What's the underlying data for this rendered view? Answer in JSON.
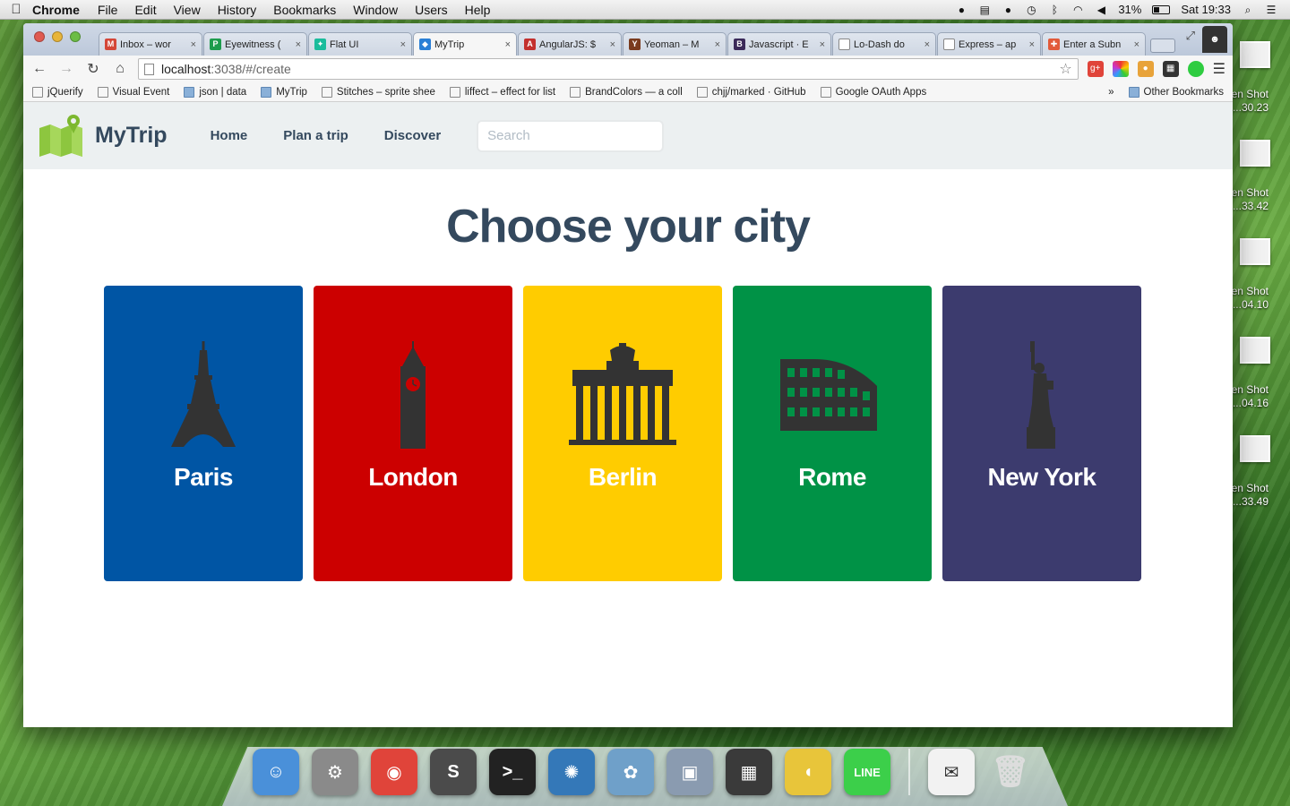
{
  "menubar": {
    "app_name": "Chrome",
    "items": [
      "File",
      "Edit",
      "View",
      "History",
      "Bookmarks",
      "Window",
      "Users",
      "Help"
    ],
    "battery": "31%",
    "clock": "Sat 19:33"
  },
  "desktop": {
    "screenshots": [
      {
        "label_line1": "en Shot",
        "label_line2": "...30.23"
      },
      {
        "label_line1": "en Shot",
        "label_line2": "...33.42"
      },
      {
        "label_line1": "en Shot",
        "label_line2": "...04.10"
      },
      {
        "label_line1": "en Shot",
        "label_line2": "...04.16"
      },
      {
        "label_line1": "en Shot",
        "label_line2": "...33.49"
      }
    ]
  },
  "tabs": [
    {
      "label": "Inbox – wor",
      "fav_text": "M",
      "fav_color": "#d44638"
    },
    {
      "label": "Eyewitness (",
      "fav_text": "P",
      "fav_color": "#1e9c4d"
    },
    {
      "label": "Flat UI",
      "fav_text": "✦",
      "fav_color": "#1abc9c"
    },
    {
      "label": "MyTrip",
      "fav_text": "◆",
      "fav_color": "#2a7fd6"
    },
    {
      "label": "AngularJS: $",
      "fav_text": "A",
      "fav_color": "#c3302e"
    },
    {
      "label": "Yeoman – M",
      "fav_text": "Y",
      "fav_color": "#7a3b1e"
    },
    {
      "label": "Javascript · E",
      "fav_text": "B",
      "fav_color": "#3b2a5a"
    },
    {
      "label": "Lo-Dash do",
      "fav_text": "",
      "fav_color": "#ffffff"
    },
    {
      "label": "Express – ap",
      "fav_text": "",
      "fav_color": "#ffffff"
    },
    {
      "label": "Enter a Subn",
      "fav_text": "✚",
      "fav_color": "#e25a3a"
    }
  ],
  "toolbar": {
    "url_host": "localhost",
    "url_path": ":3038/#/create"
  },
  "bookmarks": [
    {
      "label": "jQuerify",
      "folder": false,
      "faded": false
    },
    {
      "label": "Visual Event",
      "folder": false,
      "faded": false
    },
    {
      "label": "json | data",
      "folder": true,
      "faded": false
    },
    {
      "label": "MyTrip",
      "folder": true,
      "faded": false
    },
    {
      "label": "Stitches – sprite shee",
      "folder": false,
      "faded": false
    },
    {
      "label": "liffect – effect for list",
      "folder": false,
      "faded": false
    },
    {
      "label": "BrandColors — a coll",
      "folder": false,
      "faded": false
    },
    {
      "label": "chjj/marked · GitHub",
      "folder": false,
      "faded": false
    },
    {
      "label": "Google OAuth Apps",
      "folder": false,
      "faded": false
    }
  ],
  "bookmarks_more": "»",
  "bookmarks_other": "Other Bookmarks",
  "app": {
    "brand": "MyTrip",
    "nav": [
      "Home",
      "Plan a trip",
      "Discover"
    ],
    "search_placeholder": "Search",
    "heading": "Choose your city",
    "cities": [
      {
        "name": "Paris",
        "color": "#0055a4",
        "icon": "eiffel-tower-icon"
      },
      {
        "name": "London",
        "color": "#cc0000",
        "icon": "big-ben-icon"
      },
      {
        "name": "Berlin",
        "color": "#ffcc00",
        "icon": "brandenburg-gate-icon"
      },
      {
        "name": "Rome",
        "color": "#009246",
        "icon": "colosseum-icon"
      },
      {
        "name": "New York",
        "color": "#3c3b6e",
        "icon": "statue-of-liberty-icon"
      }
    ]
  },
  "dock": {
    "apps": [
      {
        "name": "finder",
        "glyph": "☺",
        "color": "#4a90d9"
      },
      {
        "name": "system-preferences",
        "glyph": "⚙",
        "color": "#8a8a8a"
      },
      {
        "name": "chrome",
        "glyph": "◉",
        "color": "#e0443a"
      },
      {
        "name": "sublime-text",
        "glyph": "S",
        "color": "#4b4b4b"
      },
      {
        "name": "terminal",
        "glyph": ">_",
        "color": "#222222"
      },
      {
        "name": "sourcetree",
        "glyph": "✺",
        "color": "#3478b8"
      },
      {
        "name": "preview",
        "glyph": "✿",
        "color": "#6fa0c9"
      },
      {
        "name": "iphoto",
        "glyph": "▣",
        "color": "#8a9bb0"
      },
      {
        "name": "calculator",
        "glyph": "▦",
        "color": "#3a3a3a"
      },
      {
        "name": "sequel",
        "glyph": "◖",
        "color": "#e8c53a"
      },
      {
        "name": "line",
        "glyph": "LINE",
        "color": "#3ccf4a"
      }
    ],
    "stack_glyph": "✉",
    "trash_glyph": "🗑"
  }
}
